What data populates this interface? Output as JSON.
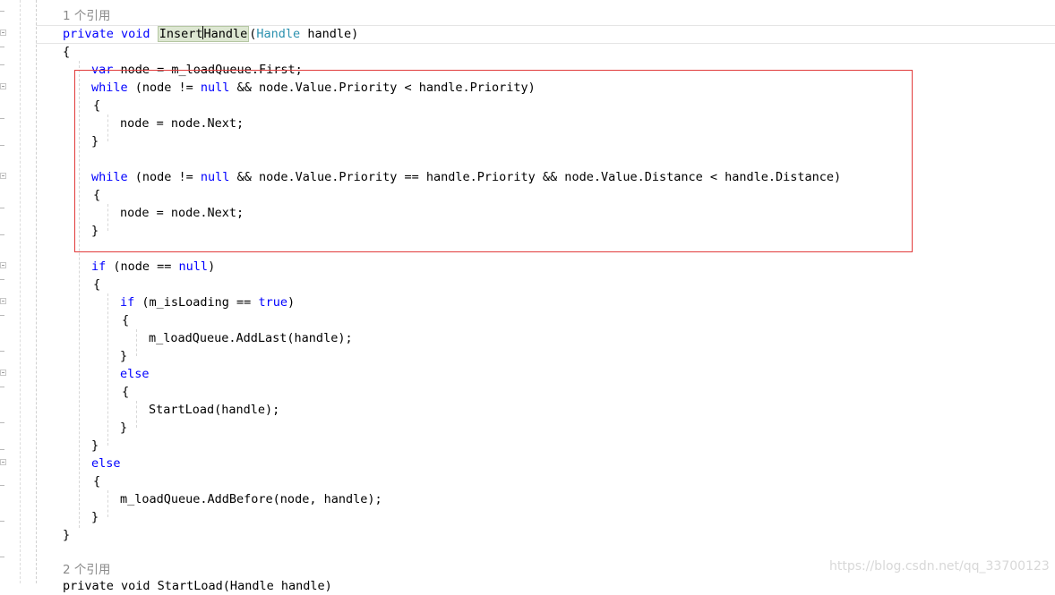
{
  "code": {
    "ref_count_1": "1 个引用",
    "sig": {
      "private": "private",
      "void": "void",
      "name_a": "Insert",
      "name_b": "Handle",
      "open": "(",
      "type": "Handle",
      "param": " handle)"
    },
    "brace_open": "{",
    "brace_close": "}",
    "line_var": {
      "kw": "var",
      "rest": " node = m_loadQueue.First;"
    },
    "while1": {
      "kw": "while",
      "a": " (node != ",
      "null": "null",
      "b": " && node.Value.Priority < handle.Priority)"
    },
    "node_next": "node = node.Next;",
    "while2": {
      "kw": "while",
      "a": " (node != ",
      "null": "null",
      "b": " && node.Value.Priority == handle.Priority && node.Value.Distance < handle.Distance)"
    },
    "if1": {
      "kw": "if",
      "a": " (node == ",
      "null": "null",
      "b": ")"
    },
    "if2": {
      "kw": "if",
      "a": " (m_isLoading == ",
      "true": "true",
      "b": ")"
    },
    "add_last": "m_loadQueue.AddLast(handle);",
    "else": "else",
    "start_load": "StartLoad(handle);",
    "add_before": "m_loadQueue.AddBefore(node, handle);",
    "ref_count_2": "2 个引用",
    "partial_next": "private void StartLoad(Handle handle)"
  },
  "watermark": "https://blog.csdn.net/qq_33700123",
  "colors": {
    "keyword": "#0000ff",
    "type": "#2b91af",
    "highlight_box": "#e13b3b"
  }
}
